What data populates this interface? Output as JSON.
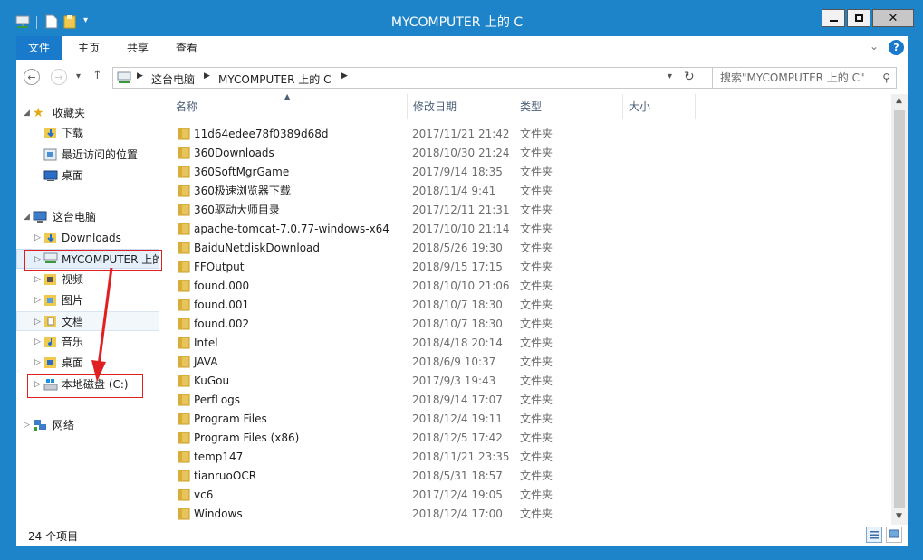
{
  "window": {
    "title": "MYCOMPUTER 上的 C"
  },
  "ribbon": {
    "tabs": [
      "文件",
      "主页",
      "共享",
      "查看"
    ]
  },
  "address": {
    "crumbs": [
      "这台电脑",
      "MYCOMPUTER 上的 C"
    ],
    "search_placeholder": "搜索\"MYCOMPUTER 上的 C\""
  },
  "nav": {
    "favorites_label": "收藏夹",
    "favorites": [
      "下载",
      "最近访问的位置",
      "桌面"
    ],
    "thispc_label": "这台电脑",
    "thispc": [
      "Downloads",
      "MYCOMPUTER 上的",
      "视频",
      "图片",
      "文档",
      "音乐",
      "桌面",
      "本地磁盘 (C:)"
    ],
    "network_label": "网络"
  },
  "columns": [
    "名称",
    "修改日期",
    "类型",
    "大小"
  ],
  "files": [
    {
      "name": "11d64edee78f0389d68d",
      "date": "2017/11/21 21:42",
      "type": "文件夹"
    },
    {
      "name": "360Downloads",
      "date": "2018/10/30 21:24",
      "type": "文件夹"
    },
    {
      "name": "360SoftMgrGame",
      "date": "2017/9/14 18:35",
      "type": "文件夹"
    },
    {
      "name": "360极速浏览器下载",
      "date": "2018/11/4 9:41",
      "type": "文件夹"
    },
    {
      "name": "360驱动大师目录",
      "date": "2017/12/11 21:31",
      "type": "文件夹"
    },
    {
      "name": "apache-tomcat-7.0.77-windows-x64",
      "date": "2017/10/10 21:14",
      "type": "文件夹"
    },
    {
      "name": "BaiduNetdiskDownload",
      "date": "2018/5/26 19:30",
      "type": "文件夹"
    },
    {
      "name": "FFOutput",
      "date": "2018/9/15 17:15",
      "type": "文件夹"
    },
    {
      "name": "found.000",
      "date": "2018/10/10 21:06",
      "type": "文件夹"
    },
    {
      "name": "found.001",
      "date": "2018/10/7 18:30",
      "type": "文件夹"
    },
    {
      "name": "found.002",
      "date": "2018/10/7 18:30",
      "type": "文件夹"
    },
    {
      "name": "Intel",
      "date": "2018/4/18 20:14",
      "type": "文件夹"
    },
    {
      "name": "JAVA",
      "date": "2018/6/9 10:37",
      "type": "文件夹"
    },
    {
      "name": "KuGou",
      "date": "2017/9/3 19:43",
      "type": "文件夹"
    },
    {
      "name": "PerfLogs",
      "date": "2018/9/14 17:07",
      "type": "文件夹"
    },
    {
      "name": "Program Files",
      "date": "2018/12/4 19:11",
      "type": "文件夹"
    },
    {
      "name": "Program Files (x86)",
      "date": "2018/12/5 17:42",
      "type": "文件夹"
    },
    {
      "name": "temp147",
      "date": "2018/11/21 23:35",
      "type": "文件夹"
    },
    {
      "name": "tianruoOCR",
      "date": "2018/5/31 18:57",
      "type": "文件夹"
    },
    {
      "name": "vc6",
      "date": "2017/12/4 19:05",
      "type": "文件夹"
    },
    {
      "name": "Windows",
      "date": "2018/12/4 17:00",
      "type": "文件夹"
    }
  ],
  "status": {
    "count": "24 个项目"
  },
  "colors": {
    "titlebar": "#1d84c9",
    "active_tab": "#1979ca",
    "folder": "#e8c55a",
    "annotation": "#e02020"
  }
}
